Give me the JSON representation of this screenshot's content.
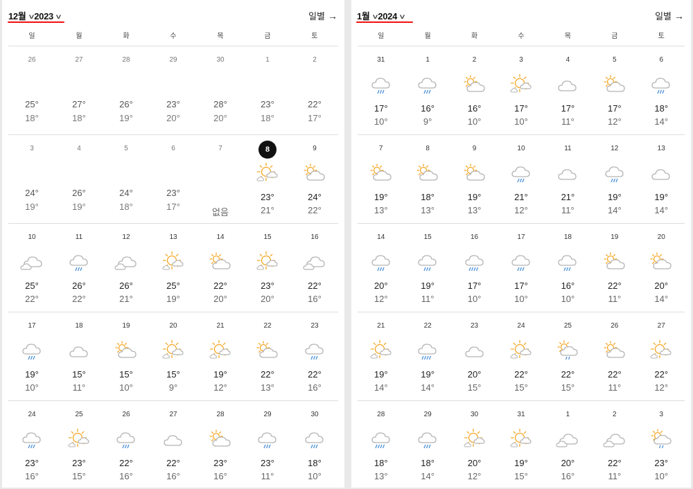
{
  "weekdays": [
    "일",
    "월",
    "화",
    "수",
    "목",
    "금",
    "토"
  ],
  "daily_label": "일별",
  "colors": {
    "accent_underline": "#e11111",
    "sun": "#f5a623",
    "cloud": "#b5b5b5",
    "rain": "#4a90d9"
  },
  "months": [
    {
      "month_label": "12월",
      "year_label": "2023",
      "weeks": [
        [
          {
            "d": "26",
            "hi": "25°",
            "lo": "18°",
            "past": true
          },
          {
            "d": "27",
            "hi": "27°",
            "lo": "18°",
            "past": true
          },
          {
            "d": "28",
            "hi": "26°",
            "lo": "19°",
            "past": true
          },
          {
            "d": "29",
            "hi": "23°",
            "lo": "20°",
            "past": true
          },
          {
            "d": "30",
            "hi": "28°",
            "lo": "20°",
            "past": true
          },
          {
            "d": "1",
            "hi": "23°",
            "lo": "18°",
            "past": true
          },
          {
            "d": "2",
            "hi": "22°",
            "lo": "17°",
            "past": true
          }
        ],
        [
          {
            "d": "3",
            "hi": "24°",
            "lo": "19°",
            "past": true
          },
          {
            "d": "4",
            "hi": "26°",
            "lo": "19°",
            "past": true
          },
          {
            "d": "5",
            "hi": "24°",
            "lo": "18°",
            "past": true
          },
          {
            "d": "6",
            "hi": "23°",
            "lo": "17°",
            "past": true
          },
          {
            "d": "7",
            "none": "없음",
            "past": true
          },
          {
            "d": "8",
            "hi": "23°",
            "lo": "21°",
            "icon": "sun-cloud-icon",
            "today": true
          },
          {
            "d": "9",
            "hi": "24°",
            "lo": "22°",
            "icon": "sun-behind-cloud-icon"
          }
        ],
        [
          {
            "d": "10",
            "hi": "25°",
            "lo": "22°",
            "icon": "clouds-icon"
          },
          {
            "d": "11",
            "hi": "26°",
            "lo": "22°",
            "icon": "rain-icon"
          },
          {
            "d": "12",
            "hi": "26°",
            "lo": "21°",
            "icon": "clouds-icon"
          },
          {
            "d": "13",
            "hi": "25°",
            "lo": "19°",
            "icon": "sun-cloud-icon"
          },
          {
            "d": "14",
            "hi": "22°",
            "lo": "20°",
            "icon": "sun-behind-cloud-icon"
          },
          {
            "d": "15",
            "hi": "23°",
            "lo": "20°",
            "icon": "sun-cloud-icon"
          },
          {
            "d": "16",
            "hi": "22°",
            "lo": "16°",
            "icon": "clouds-icon"
          }
        ],
        [
          {
            "d": "17",
            "hi": "19°",
            "lo": "10°",
            "icon": "rain-icon"
          },
          {
            "d": "18",
            "hi": "15°",
            "lo": "11°",
            "icon": "cloud-icon"
          },
          {
            "d": "19",
            "hi": "15°",
            "lo": "10°",
            "icon": "sun-behind-cloud-icon"
          },
          {
            "d": "20",
            "hi": "15°",
            "lo": "9°",
            "icon": "sun-cloud-icon"
          },
          {
            "d": "21",
            "hi": "19°",
            "lo": "12°",
            "icon": "sun-cloud-icon"
          },
          {
            "d": "22",
            "hi": "22°",
            "lo": "13°",
            "icon": "sun-behind-cloud-icon"
          },
          {
            "d": "23",
            "hi": "22°",
            "lo": "16°",
            "icon": "rain-icon"
          }
        ],
        [
          {
            "d": "24",
            "hi": "23°",
            "lo": "16°",
            "icon": "rain-icon"
          },
          {
            "d": "25",
            "hi": "23°",
            "lo": "15°",
            "icon": "sun-cloud-icon"
          },
          {
            "d": "26",
            "hi": "22°",
            "lo": "16°",
            "icon": "rain-icon"
          },
          {
            "d": "27",
            "hi": "22°",
            "lo": "16°",
            "icon": "cloud-icon"
          },
          {
            "d": "28",
            "hi": "23°",
            "lo": "16°",
            "icon": "sun-behind-cloud-icon"
          },
          {
            "d": "29",
            "hi": "23°",
            "lo": "11°",
            "icon": "rain-icon"
          },
          {
            "d": "30",
            "hi": "18°",
            "lo": "10°",
            "icon": "rain-icon"
          }
        ]
      ]
    },
    {
      "month_label": "1월",
      "year_label": "2024",
      "weeks": [
        [
          {
            "d": "31",
            "hi": "17°",
            "lo": "10°",
            "icon": "rain-icon"
          },
          {
            "d": "1",
            "hi": "16°",
            "lo": "9°",
            "icon": "rain-icon"
          },
          {
            "d": "2",
            "hi": "16°",
            "lo": "10°",
            "icon": "sun-behind-cloud-icon"
          },
          {
            "d": "3",
            "hi": "17°",
            "lo": "10°",
            "icon": "sun-cloud-icon"
          },
          {
            "d": "4",
            "hi": "17°",
            "lo": "11°",
            "icon": "cloud-icon"
          },
          {
            "d": "5",
            "hi": "17°",
            "lo": "12°",
            "icon": "sun-behind-cloud-icon"
          },
          {
            "d": "6",
            "hi": "18°",
            "lo": "14°",
            "icon": "rain-icon"
          }
        ],
        [
          {
            "d": "7",
            "hi": "19°",
            "lo": "13°",
            "icon": "sun-behind-cloud-icon"
          },
          {
            "d": "8",
            "hi": "18°",
            "lo": "13°",
            "icon": "sun-behind-cloud-icon"
          },
          {
            "d": "9",
            "hi": "19°",
            "lo": "13°",
            "icon": "sun-behind-cloud-icon"
          },
          {
            "d": "10",
            "hi": "21°",
            "lo": "12°",
            "icon": "rain-icon"
          },
          {
            "d": "11",
            "hi": "21°",
            "lo": "11°",
            "icon": "cloud-icon"
          },
          {
            "d": "12",
            "hi": "19°",
            "lo": "14°",
            "icon": "rain-icon"
          },
          {
            "d": "13",
            "hi": "19°",
            "lo": "14°",
            "icon": "cloud-icon"
          }
        ],
        [
          {
            "d": "14",
            "hi": "20°",
            "lo": "12°",
            "icon": "rain-icon"
          },
          {
            "d": "15",
            "hi": "19°",
            "lo": "11°",
            "icon": "rain-icon"
          },
          {
            "d": "16",
            "hi": "17°",
            "lo": "10°",
            "icon": "heavy-rain-icon"
          },
          {
            "d": "17",
            "hi": "17°",
            "lo": "10°",
            "icon": "rain-icon"
          },
          {
            "d": "18",
            "hi": "16°",
            "lo": "10°",
            "icon": "rain-icon"
          },
          {
            "d": "19",
            "hi": "22°",
            "lo": "11°",
            "icon": "sun-behind-cloud-icon"
          },
          {
            "d": "20",
            "hi": "20°",
            "lo": "14°",
            "icon": "sun-behind-cloud-icon"
          }
        ],
        [
          {
            "d": "21",
            "hi": "19°",
            "lo": "14°",
            "icon": "sun-cloud-icon"
          },
          {
            "d": "22",
            "hi": "19°",
            "lo": "14°",
            "icon": "heavy-rain-icon"
          },
          {
            "d": "23",
            "hi": "20°",
            "lo": "15°",
            "icon": "cloud-icon"
          },
          {
            "d": "24",
            "hi": "22°",
            "lo": "15°",
            "icon": "sun-cloud-icon"
          },
          {
            "d": "25",
            "hi": "22°",
            "lo": "15°",
            "icon": "sun-rain-icon"
          },
          {
            "d": "26",
            "hi": "22°",
            "lo": "11°",
            "icon": "sun-behind-cloud-icon"
          },
          {
            "d": "27",
            "hi": "22°",
            "lo": "12°",
            "icon": "sun-cloud-icon"
          }
        ],
        [
          {
            "d": "28",
            "hi": "18°",
            "lo": "13°",
            "icon": "heavy-rain-icon"
          },
          {
            "d": "29",
            "hi": "18°",
            "lo": "14°",
            "icon": "rain-icon"
          },
          {
            "d": "30",
            "hi": "20°",
            "lo": "12°",
            "icon": "sun-cloud-icon"
          },
          {
            "d": "31",
            "hi": "19°",
            "lo": "15°",
            "icon": "sun-cloud-icon"
          },
          {
            "d": "1",
            "hi": "20°",
            "lo": "16°",
            "icon": "clouds-icon"
          },
          {
            "d": "2",
            "hi": "22°",
            "lo": "11°",
            "icon": "clouds-icon"
          },
          {
            "d": "3",
            "hi": "23°",
            "lo": "10°",
            "icon": "sun-rain-icon"
          }
        ]
      ]
    }
  ]
}
